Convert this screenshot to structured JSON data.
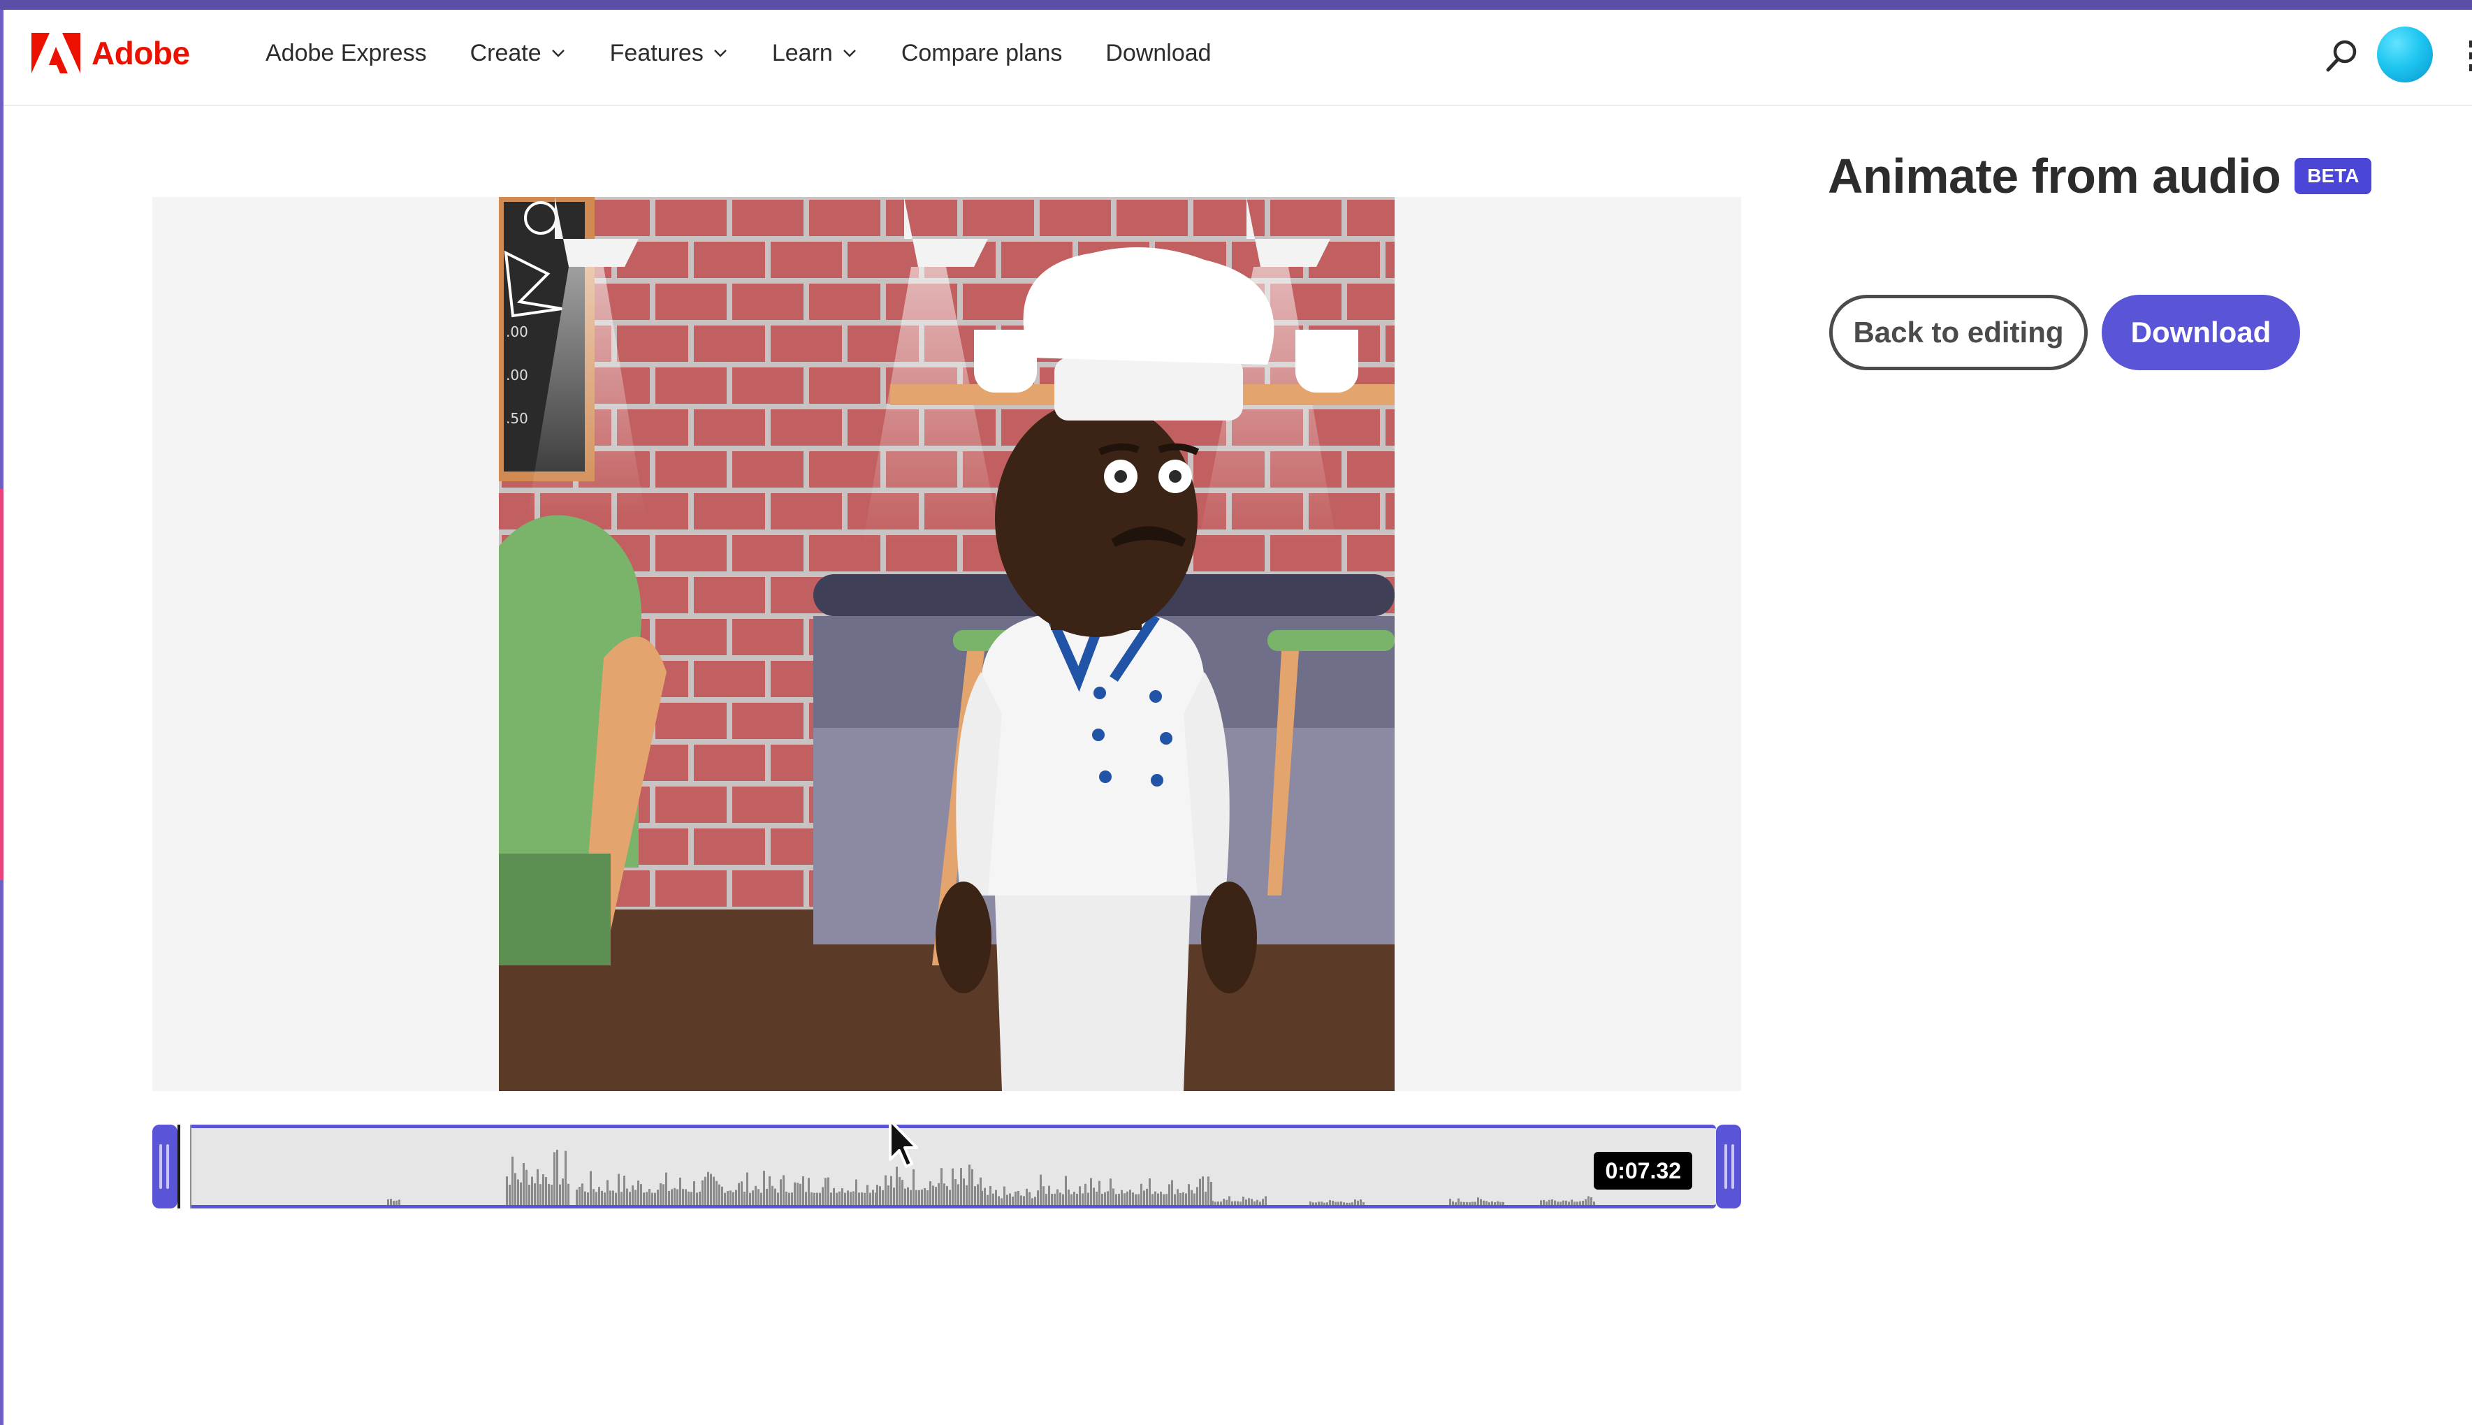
{
  "brand": {
    "name": "Adobe",
    "color": "#eb1000"
  },
  "nav": {
    "items": [
      {
        "label": "Adobe Express",
        "dropdown": false
      },
      {
        "label": "Create",
        "dropdown": true
      },
      {
        "label": "Features",
        "dropdown": true
      },
      {
        "label": "Learn",
        "dropdown": true
      },
      {
        "label": "Compare plans",
        "dropdown": false
      },
      {
        "label": "Download",
        "dropdown": false
      }
    ],
    "icons": [
      "search-icon",
      "avatar",
      "apps-grid-icon"
    ]
  },
  "panel": {
    "title": "Animate from audio",
    "badge": "BETA",
    "back_label": "Back to editing",
    "download_label": "Download"
  },
  "timeline": {
    "time": "0:07.32",
    "playhead_fraction": 0.0
  },
  "colors": {
    "accent": "#5a55d6",
    "badge": "#4c46d6",
    "brand_red": "#eb1000"
  }
}
